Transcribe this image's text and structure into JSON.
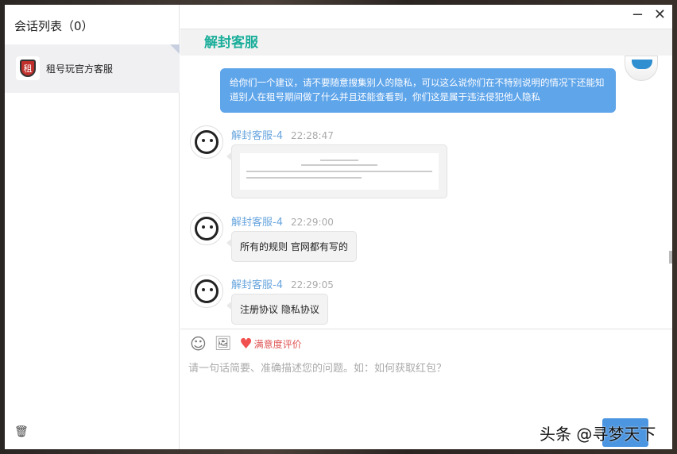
{
  "sidebar": {
    "title": "会话列表（0）",
    "sessions": [
      {
        "name": "租号玩官方客服",
        "logo_text": "租"
      }
    ]
  },
  "window": {
    "minimize": "−",
    "close": "✕"
  },
  "chat": {
    "title": "解封客服",
    "user_message": "给你们一个建议，请不要随意搜集别人的隐私，可以这么说你们在不特别说明的情况下还能知道别人在租号期间做了什么并且还能查看到，你们这是属于违法侵犯他人隐私",
    "messages": [
      {
        "sender": "解封客服-4",
        "time": "22:28:47",
        "type": "image"
      },
      {
        "sender": "解封客服-4",
        "time": "22:29:00",
        "text": "所有的规则 官网都有写的"
      },
      {
        "sender": "解封客服-4",
        "time": "22:29:05",
        "text": "注册协议 隐私协议"
      }
    ]
  },
  "input": {
    "rating_label": "满意度评价",
    "placeholder": "请一句话简要、准确描述您的问题。如：如何获取红包？"
  },
  "watermark": "头条 @寻梦天下",
  "colors": {
    "accent": "#1aae9a",
    "bubble": "#5fa5ea",
    "send": "#4c95e0"
  }
}
